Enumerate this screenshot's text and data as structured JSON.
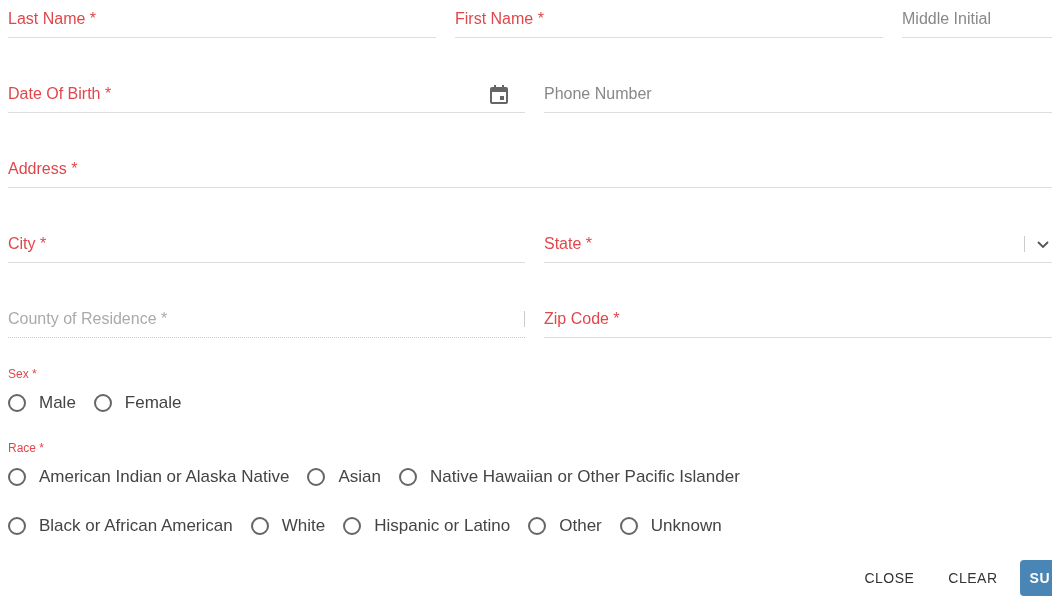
{
  "rows": [
    {
      "fields": [
        {
          "label": "Last Name *",
          "kind": "text",
          "error": true,
          "disabled": false
        },
        {
          "label": "First Name *",
          "kind": "text",
          "error": true,
          "disabled": false
        },
        {
          "label": "Middle Initial",
          "kind": "text",
          "error": false,
          "disabled": false
        }
      ]
    },
    {
      "fields": [
        {
          "label": "Date Of Birth *",
          "kind": "date",
          "error": true,
          "disabled": false
        },
        {
          "label": "Phone Number",
          "kind": "text",
          "error": false,
          "disabled": false
        }
      ]
    },
    {
      "fields": [
        {
          "label": "Address *",
          "kind": "text",
          "error": true,
          "disabled": false
        }
      ]
    },
    {
      "fields": [
        {
          "label": "City *",
          "kind": "text",
          "error": true,
          "disabled": false
        },
        {
          "label": "State *",
          "kind": "select",
          "error": true,
          "disabled": false
        }
      ]
    },
    {
      "fields": [
        {
          "label": "County of Residence *",
          "kind": "autocomplete",
          "error": false,
          "disabled": true
        },
        {
          "label": "Zip Code *",
          "kind": "text",
          "error": true,
          "disabled": false
        }
      ]
    }
  ],
  "sex": {
    "label": "Sex *",
    "error": true,
    "rows": [
      [
        {
          "label": "Male",
          "selected": false
        },
        {
          "label": "Female",
          "selected": false
        }
      ]
    ]
  },
  "race": {
    "label": "Race *",
    "error": true,
    "rows": [
      [
        {
          "label": "American Indian or Alaska Native",
          "selected": false
        },
        {
          "label": "Asian",
          "selected": false
        },
        {
          "label": "Native Hawaiian or Other Pacific Islander",
          "selected": false
        }
      ],
      [
        {
          "label": "Black or African American",
          "selected": false
        },
        {
          "label": "White",
          "selected": false
        },
        {
          "label": "Hispanic or Latino",
          "selected": false
        },
        {
          "label": "Other",
          "selected": false
        },
        {
          "label": "Unknown",
          "selected": false
        }
      ]
    ]
  },
  "buttons": [
    {
      "label": "CLOSE",
      "kind": "text"
    },
    {
      "label": "CLEAR",
      "kind": "text"
    },
    {
      "label": "SU",
      "kind": "primary"
    }
  ]
}
